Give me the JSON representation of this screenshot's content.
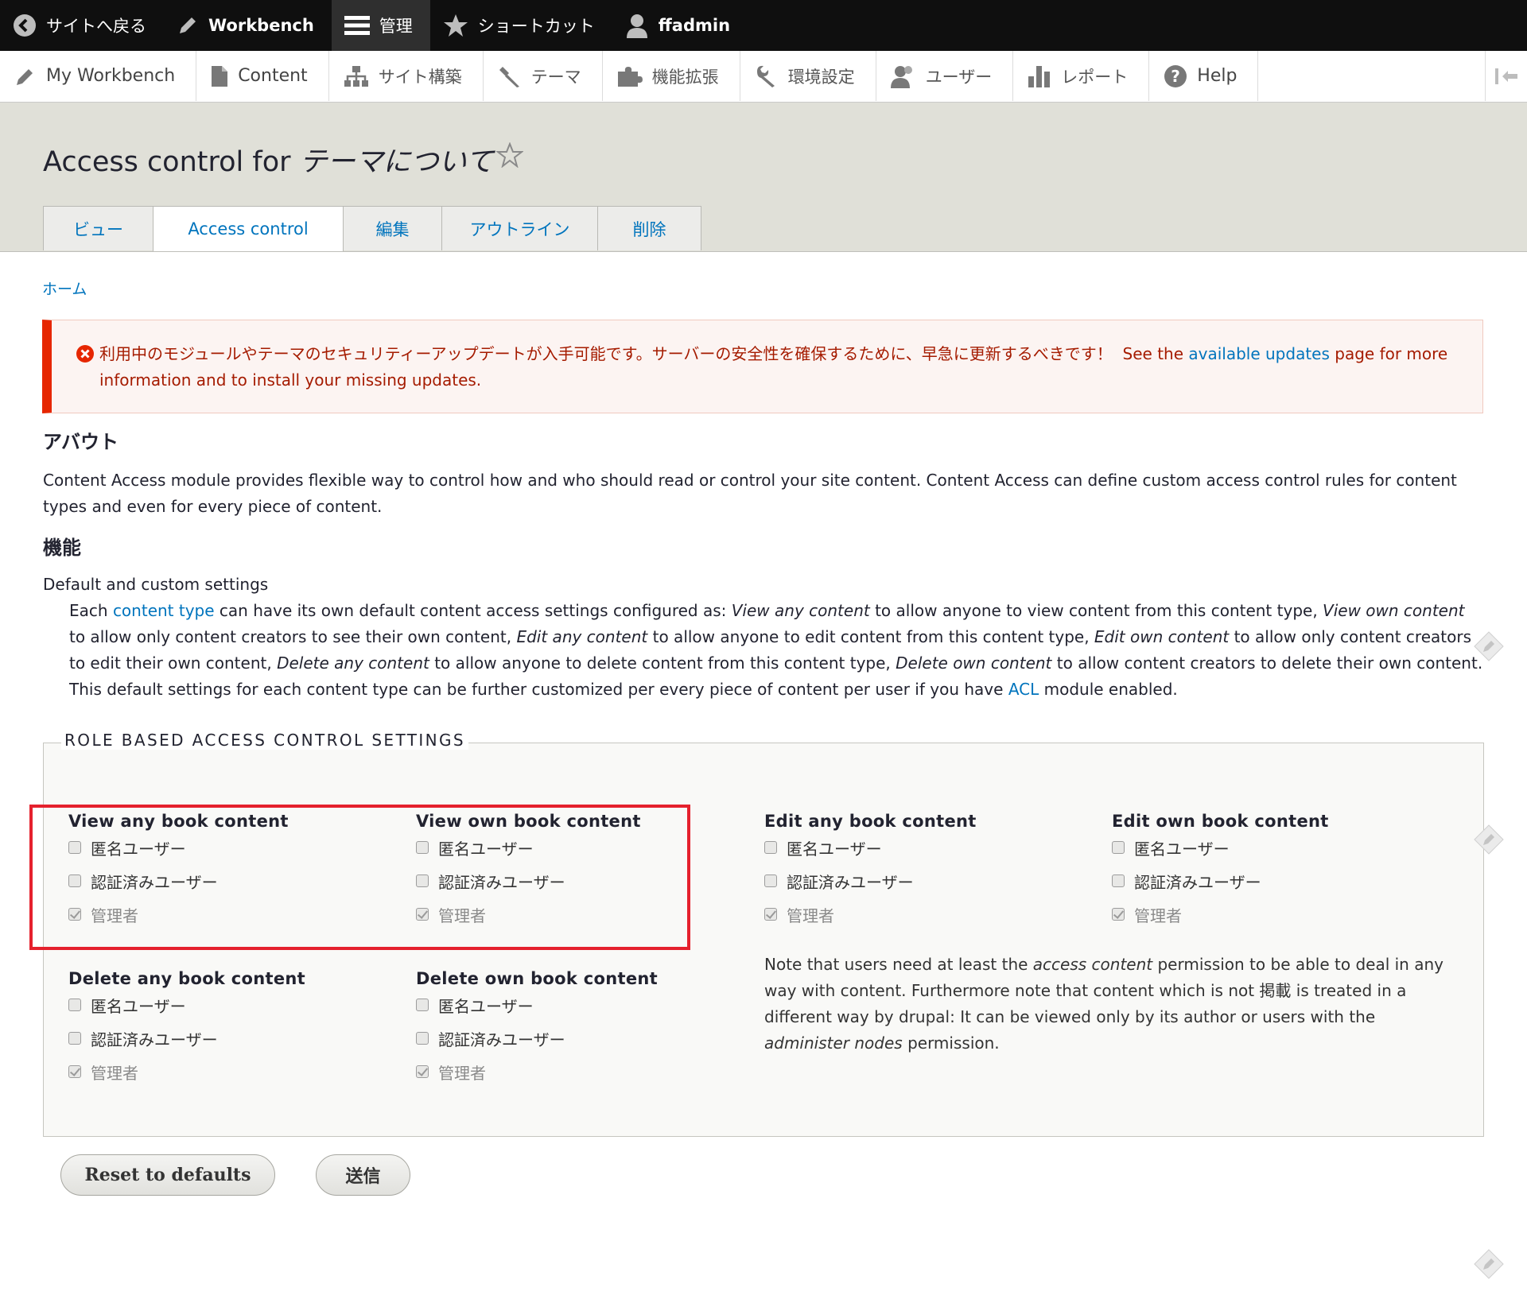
{
  "toolbar": {
    "back": "サイトへ戻る",
    "workbench": "Workbench",
    "manage": "管理",
    "shortcuts": "ショートカット",
    "user": "ffadmin"
  },
  "tray": {
    "items": [
      {
        "label": "My Workbench",
        "icon": "pencil-icon"
      },
      {
        "label": "Content",
        "icon": "page-icon"
      },
      {
        "label": "サイト構築",
        "icon": "sitemap-icon"
      },
      {
        "label": "テーマ",
        "icon": "paintbrush-icon"
      },
      {
        "label": "機能拡張",
        "icon": "puzzle-icon"
      },
      {
        "label": "環境設定",
        "icon": "wrench-icon"
      },
      {
        "label": "ユーザー",
        "icon": "people-icon"
      },
      {
        "label": "レポート",
        "icon": "bar-chart-icon"
      },
      {
        "label": "Help",
        "icon": "help-icon"
      }
    ]
  },
  "header": {
    "title_prefix": "Access control for",
    "title_node": "テーマについて",
    "tabs": [
      {
        "label": "ビュー",
        "active": false
      },
      {
        "label": "Access control",
        "active": true
      },
      {
        "label": "編集",
        "active": false
      },
      {
        "label": "アウトライン",
        "active": false
      },
      {
        "label": "削除",
        "active": false
      }
    ]
  },
  "breadcrumb": {
    "home": "ホーム"
  },
  "message": {
    "text_ja": "利用中のモジュールやテーマのセキュリティーアップデートが入手可能です。サーバーの安全性を確保するために、早急に更新するべきです！",
    "text_see": "See the",
    "link": "available updates",
    "text_after": "page for more information and to install your missing updates."
  },
  "help": {
    "about_heading": "アバウト",
    "about_text": "Content Access module provides flexible way to control how and who should read or control your site content. Content Access can define custom access control rules for content types and even for every piece of content.",
    "features_heading": "機能",
    "dt": "Default and custom settings",
    "dd": {
      "t1": "Each",
      "l1": "content type",
      "t2": "can have its own default content access settings configured as:",
      "e1": "View any content",
      "t3": "to allow anyone to view content from this content type,",
      "e2": "View own content",
      "t4": "to allow only content creators to see their own content,",
      "e3": "Edit any content",
      "t5": "to allow anyone to edit content from this content type,",
      "e4": "Edit own content",
      "t6": "to allow only content creators to edit their own content,",
      "e5": "Delete any content",
      "t7": "to allow anyone to delete content from this content type,",
      "e6": "Delete own content",
      "t8": "to allow content creators to delete their own content. This default settings for each content type can be further customized per every piece of content per user if you have",
      "l2": "ACL",
      "t9": "module enabled."
    }
  },
  "settings": {
    "legend": "ROLE BASED ACCESS CONTROL SETTINGS",
    "groups": [
      {
        "title": "View any book content",
        "roles": [
          {
            "label": "匿名ユーザー",
            "checked": false
          },
          {
            "label": "認証済みユーザー",
            "checked": false
          },
          {
            "label": "管理者",
            "checked": true
          }
        ]
      },
      {
        "title": "View own book content",
        "roles": [
          {
            "label": "匿名ユーザー",
            "checked": false
          },
          {
            "label": "認証済みユーザー",
            "checked": false
          },
          {
            "label": "管理者",
            "checked": true
          }
        ]
      },
      {
        "title": "Edit any book content",
        "roles": [
          {
            "label": "匿名ユーザー",
            "checked": false
          },
          {
            "label": "認証済みユーザー",
            "checked": false
          },
          {
            "label": "管理者",
            "checked": true
          }
        ]
      },
      {
        "title": "Edit own book content",
        "roles": [
          {
            "label": "匿名ユーザー",
            "checked": false
          },
          {
            "label": "認証済みユーザー",
            "checked": false
          },
          {
            "label": "管理者",
            "checked": true
          }
        ]
      },
      {
        "title": "Delete any book content",
        "roles": [
          {
            "label": "匿名ユーザー",
            "checked": false
          },
          {
            "label": "認証済みユーザー",
            "checked": false
          },
          {
            "label": "管理者",
            "checked": true
          }
        ]
      },
      {
        "title": "Delete own book content",
        "roles": [
          {
            "label": "匿名ユーザー",
            "checked": false
          },
          {
            "label": "認証済みユーザー",
            "checked": false
          },
          {
            "label": "管理者",
            "checked": true
          }
        ]
      }
    ],
    "note": {
      "t1": "Note that users need at least the",
      "e1": "access content",
      "t2": "permission to be able to deal in any way with content. Furthermore note that content which is not 掲載 is treated in a different way by drupal: It can be viewed only by its author or users with the",
      "e2": "administer nodes",
      "t3": "permission."
    }
  },
  "buttons": {
    "reset": "Reset to defaults",
    "submit": "送信"
  },
  "colors": {
    "link": "#0074bd",
    "error_border": "#e62600",
    "highlight": "#e5212d"
  }
}
